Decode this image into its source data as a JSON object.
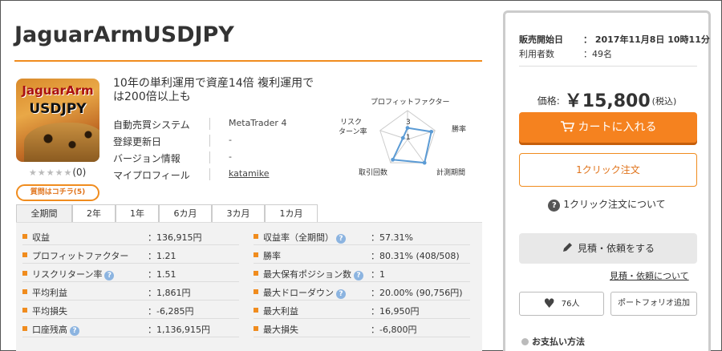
{
  "product": {
    "title": "JaguarArmUSDJPY",
    "thumb_line1": "JaguarArm",
    "thumb_line2": "USDJPY",
    "rating_stars": "★★★★★",
    "rating_count": "(0)",
    "ask_button": "質問はコチラ(5)",
    "description": "10年の単利運用で資産14倍 複利運用では200倍以上も"
  },
  "info": [
    {
      "key": "自動売買システム",
      "value": "MetaTrader 4"
    },
    {
      "key": "登録更新日",
      "value": "-"
    },
    {
      "key": "バージョン情報",
      "value": "-"
    },
    {
      "key": "マイプロフィール",
      "value": "katamike"
    }
  ],
  "radar": {
    "axes": [
      "プロフィットファクター",
      "勝率",
      "計測期間",
      "取引回数",
      "リスクリターン率"
    ],
    "axis_label_risk_1": "リスク",
    "axis_label_risk_2": "ターン率",
    "scale_label_3": "3",
    "scale_label_1": "1",
    "values": [
      1.2,
      2.6,
      3.0,
      2.6,
      0.5
    ],
    "max": 3,
    "accent": "#5b9bd5"
  },
  "tabs": [
    "全期間",
    "2年",
    "1年",
    "6カ月",
    "3カ月",
    "1カ月"
  ],
  "stats_left": [
    {
      "label": "収益",
      "value": "：136,915円",
      "help": false
    },
    {
      "label": "プロフィットファクター",
      "value": "：1.21",
      "help": false
    },
    {
      "label": "リスクリターン率",
      "value": "：1.51",
      "help": true
    },
    {
      "label": "平均利益",
      "value": "：1,861円",
      "help": false
    },
    {
      "label": "平均損失",
      "value": "：-6,285円",
      "help": false
    },
    {
      "label": "口座残高",
      "value": "：1,136,915円",
      "help": true
    }
  ],
  "stats_right": [
    {
      "label": "収益率（全期間）",
      "value": "：57.31%",
      "help": true
    },
    {
      "label": "勝率",
      "value": "：80.31% (408/508)",
      "help": false
    },
    {
      "label": "最大保有ポジション数",
      "value": "：1",
      "help": true
    },
    {
      "label": "最大ドローダウン",
      "value": "：20.00% (90,756円)",
      "help": true
    },
    {
      "label": "最大利益",
      "value": "：16,950円",
      "help": false
    },
    {
      "label": "最大損失",
      "value": "：-6,800円",
      "help": false
    }
  ],
  "help_glyph": "?",
  "sidebar": {
    "start_label": "販売開始日",
    "start_value": "：  2017年11月8日 10時11分",
    "users_label": "利用者数",
    "users_value": "：49名",
    "price_label": "価格:",
    "price_value": "￥15,800",
    "price_tax": "(税込)",
    "cart_button": "カートに入れる",
    "oneclick_button": "1クリック注文",
    "oneclick_info_glyph": "?",
    "oneclick_info": "1クリック注文について",
    "estimate_button": "見積・依頼をする",
    "estimate_link": "見積・依頼について",
    "fav_count": "76人",
    "portfolio_button": "ポートフォリオ追加",
    "payment_title": "お支払い方法"
  },
  "colors": {
    "accent": "#f08c1e",
    "cart": "#f5821f",
    "help": "#8cb4e0"
  }
}
